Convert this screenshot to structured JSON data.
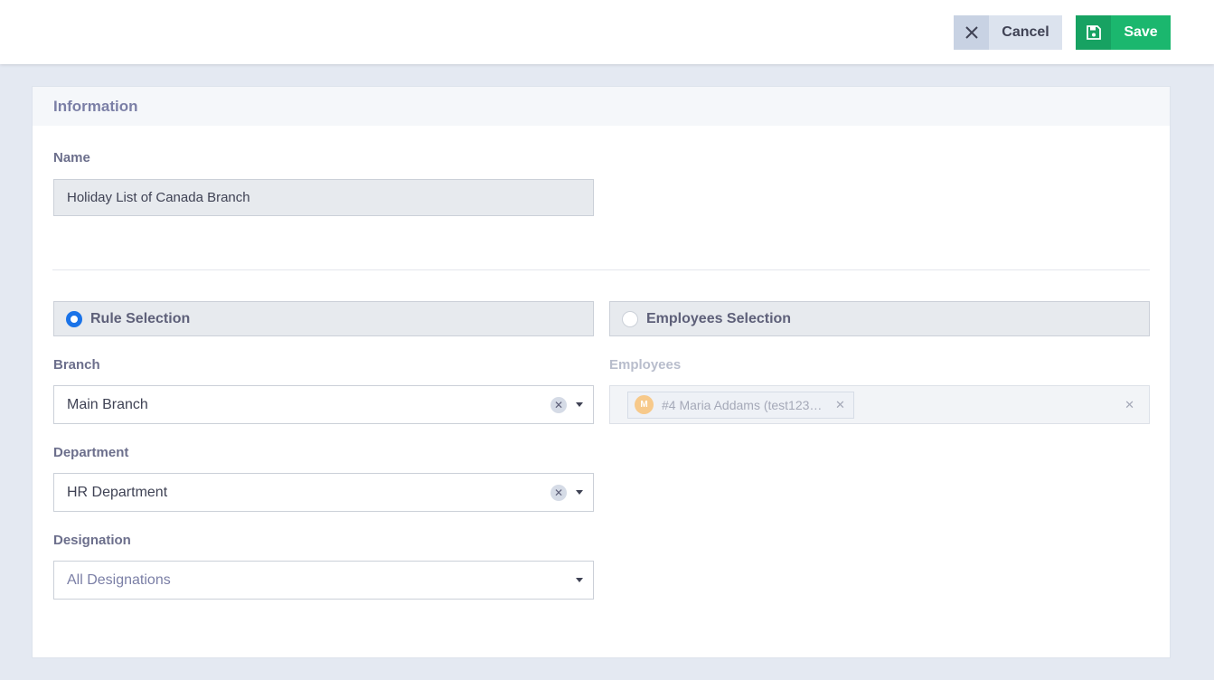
{
  "toolbar": {
    "cancel_label": "Cancel",
    "save_label": "Save"
  },
  "card": {
    "title": "Information"
  },
  "name_field": {
    "label": "Name",
    "value": "Holiday List of Canada Branch"
  },
  "selection_mode": {
    "rule_label": "Rule Selection",
    "employees_label": "Employees Selection",
    "selected": "Rule Selection"
  },
  "branch": {
    "label": "Branch",
    "value": "Main Branch"
  },
  "department": {
    "label": "Department",
    "value": "HR Department"
  },
  "designation": {
    "label": "Designation",
    "placeholder": "All Designations"
  },
  "employees": {
    "label": "Employees",
    "chip_initial": "M",
    "chip_text": "#4 Maria Addams (test1234…"
  },
  "colors": {
    "save_green": "#1bb76e",
    "radio_blue": "#1a73e8",
    "page_bg": "#e4e9f2"
  }
}
